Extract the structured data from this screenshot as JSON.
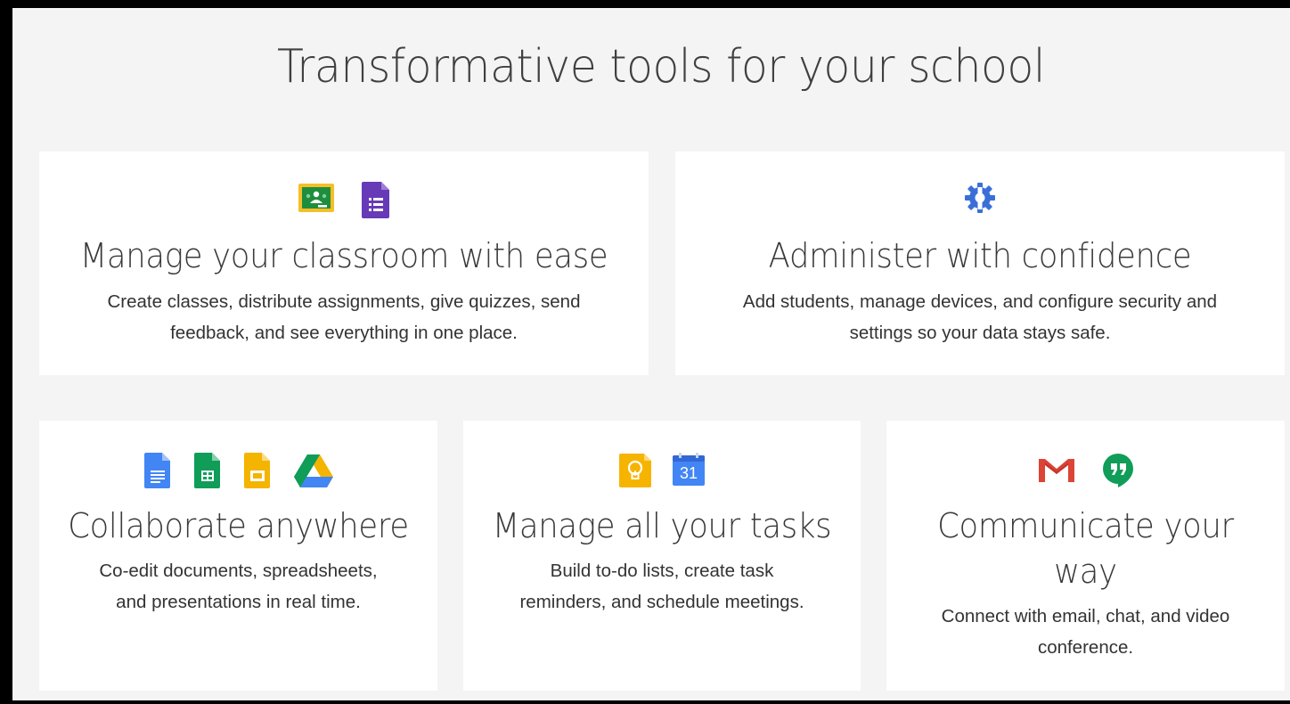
{
  "page": {
    "title": "Transformative tools for your school"
  },
  "cards": [
    {
      "heading": "Manage your classroom with ease",
      "description_line1": "Create classes, distribute assignments, give quizzes, send",
      "description_line2": "feedback, and see everything in one place.",
      "icons": [
        "google-classroom-icon",
        "google-forms-icon"
      ]
    },
    {
      "heading": "Administer with confidence",
      "description_line1": "Add students, manage devices, and configure security and",
      "description_line2": "settings so your data stays safe.",
      "icons": [
        "admin-console-icon"
      ]
    },
    {
      "heading": "Collaborate anywhere",
      "description_line1": "Co-edit documents, spreadsheets,",
      "description_line2": "and presentations in real time.",
      "icons": [
        "google-docs-icon",
        "google-sheets-icon",
        "google-slides-icon",
        "google-drive-icon"
      ]
    },
    {
      "heading": "Manage all your tasks",
      "description_line1": "Build to-do lists, create task",
      "description_line2": "reminders, and schedule meetings.",
      "icons": [
        "google-keep-icon",
        "google-calendar-icon"
      ],
      "calendar_day": "31"
    },
    {
      "heading_line1": "Communicate your",
      "heading_line2": "way",
      "description_line1": "Connect with email, chat, and video",
      "description_line2": "conference.",
      "icons": [
        "gmail-icon",
        "hangouts-icon"
      ]
    }
  ],
  "colors": {
    "background": "#f4f4f4",
    "card": "#ffffff",
    "classroom_green": "#1e8e3e",
    "classroom_yellow": "#f6bf26",
    "forms_purple": "#673ab7",
    "admin_blue": "#3b6fd8",
    "docs_blue": "#4285f4",
    "sheets_green": "#0f9d58",
    "slides_yellow": "#f4b400",
    "keep_yellow": "#f6b400",
    "calendar_blue": "#4285f4",
    "gmail_red": "#db4437",
    "hangouts_green": "#0f9d58"
  }
}
